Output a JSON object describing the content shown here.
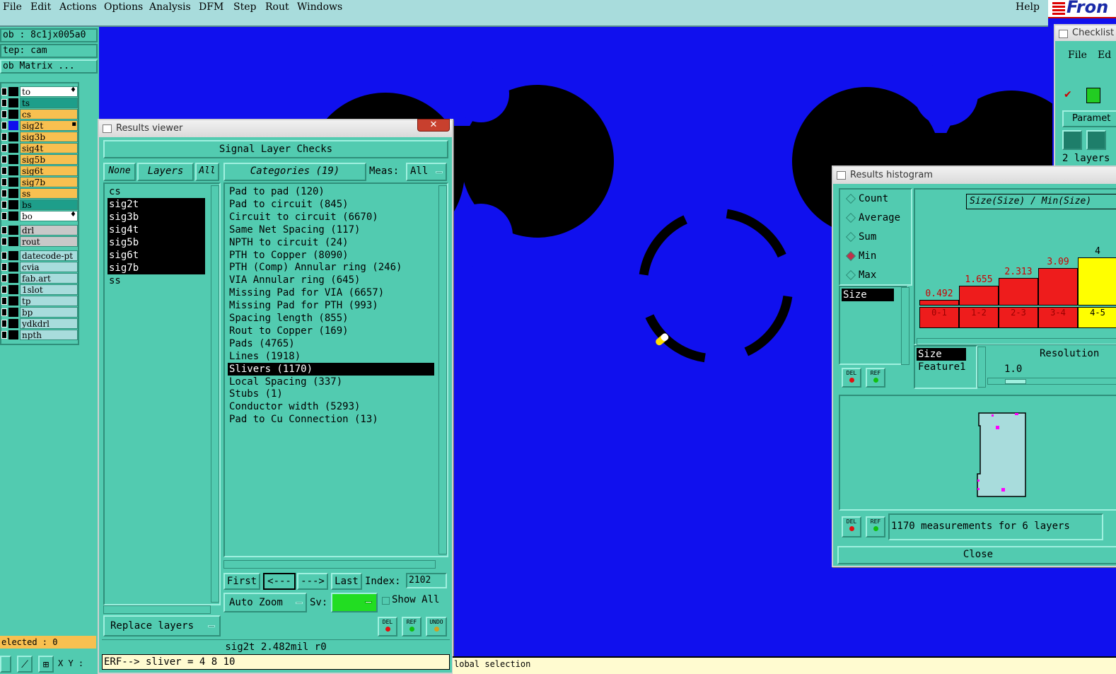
{
  "menubar": {
    "items": [
      "File",
      "Edit",
      "Actions",
      "Options",
      "Analysis",
      "DFM",
      "Step",
      "Rout",
      "Windows"
    ],
    "help": "Help",
    "logo": "Fron"
  },
  "left_panel": {
    "job": "ob : 8c1jx005a0",
    "step": "tep: cam",
    "job_matrix": "ob Matrix ...",
    "layers": [
      {
        "name": "to",
        "color": "#ffffff",
        "swatch": "#000000",
        "mark": "♦"
      },
      {
        "name": "ts",
        "color": "#1e9e8a",
        "swatch": "#000000",
        "mark": ""
      },
      {
        "name": "cs",
        "color": "#f8c050",
        "swatch": "#000000",
        "mark": ""
      },
      {
        "name": "sig2t",
        "color": "#f8c050",
        "swatch": "#1010ee",
        "mark": "▪"
      },
      {
        "name": "sig3b",
        "color": "#f8c050",
        "swatch": "#000000",
        "mark": ""
      },
      {
        "name": "sig4t",
        "color": "#f8c050",
        "swatch": "#000000",
        "mark": ""
      },
      {
        "name": "sig5b",
        "color": "#f8c050",
        "swatch": "#000000",
        "mark": ""
      },
      {
        "name": "sig6t",
        "color": "#f8c050",
        "swatch": "#000000",
        "mark": ""
      },
      {
        "name": "sig7b",
        "color": "#f8c050",
        "swatch": "#000000",
        "mark": ""
      },
      {
        "name": "ss",
        "color": "#f8c050",
        "swatch": "#000000",
        "mark": ""
      },
      {
        "name": "bs",
        "color": "#1e9e8a",
        "swatch": "#000000",
        "mark": ""
      },
      {
        "name": "bo",
        "color": "#ffffff",
        "swatch": "#000000",
        "mark": "♦"
      },
      {
        "name": "drl",
        "color": "#c8c8c8",
        "swatch": "#000000",
        "mark": ""
      },
      {
        "name": "rout",
        "color": "#c8c8c8",
        "swatch": "#000000",
        "mark": ""
      },
      {
        "name": "datecode-pt",
        "color": "#a8dcdc",
        "swatch": "#000000",
        "mark": ""
      },
      {
        "name": "cvia",
        "color": "#a8dcdc",
        "swatch": "#000000",
        "mark": ""
      },
      {
        "name": "fab.art",
        "color": "#a8dcdc",
        "swatch": "#000000",
        "mark": ""
      },
      {
        "name": "1slot",
        "color": "#a8dcdc",
        "swatch": "#000000",
        "mark": ""
      },
      {
        "name": "tp",
        "color": "#a8dcdc",
        "swatch": "#000000",
        "mark": ""
      },
      {
        "name": "bp",
        "color": "#a8dcdc",
        "swatch": "#000000",
        "mark": ""
      },
      {
        "name": "ydkdrl",
        "color": "#a8dcdc",
        "swatch": "#000000",
        "mark": ""
      },
      {
        "name": "npth",
        "color": "#a8dcdc",
        "swatch": "#000000",
        "mark": ""
      }
    ],
    "selected": "elected : 0",
    "xy_label": "X Y :"
  },
  "results_viewer": {
    "title": "Results viewer",
    "header": "Signal Layer Checks",
    "none_btn": "None",
    "layers_btn": "Layers",
    "all_btn": "All",
    "categories_btn": "Categories (19)",
    "meas_label": "Meas:",
    "meas_value": "All",
    "layer_list": [
      "cs",
      "sig2t",
      "sig3b",
      "sig4t",
      "sig5b",
      "sig6t",
      "sig7b",
      "ss"
    ],
    "selected_layers": [
      "sig2t",
      "sig3b",
      "sig4t",
      "sig5b",
      "sig6t",
      "sig7b"
    ],
    "categories": [
      "Pad to pad (120)",
      "Pad to circuit (845)",
      "Circuit to circuit (6670)",
      "Same Net Spacing (117)",
      "NPTH to circuit (24)",
      "PTH to Copper (8090)",
      "PTH (Comp) Annular ring (246)",
      "VIA Annular ring (645)",
      "Missing Pad for VIA (6657)",
      "Missing Pad for PTH (993)",
      "Spacing length (855)",
      "Rout to Copper (169)",
      "Pads (4765)",
      "Lines (1918)",
      "Slivers (1170)",
      "Local Spacing (337)",
      "Stubs (1)",
      "Conductor width (5293)",
      "Pad to Cu Connection (13)"
    ],
    "selected_category": "Slivers (1170)",
    "first_btn": "First",
    "prev_btn": "<---",
    "next_btn": "--->",
    "last_btn": "Last",
    "index_label": "Index:",
    "index_value": "2102",
    "auto_zoom": "Auto Zoom",
    "sv_label": "Sv:",
    "show_all": "Show All",
    "replace_layers": "Replace layers",
    "del_label": "DEL",
    "ref_label": "REF",
    "undo_label": "UNDO",
    "status_line": "sig2t 2.482mil  r0",
    "erf_line": "ERF--> sliver = 4 8 10"
  },
  "histogram": {
    "title": "Results histogram",
    "modes": [
      "Count",
      "Average",
      "Sum",
      "Min",
      "Max"
    ],
    "selected_mode": "Min",
    "size_item": "Size",
    "chart_title": "Size(Size) / Min(Size)",
    "resolution_label": "Resolution",
    "resolution_value": "1.0",
    "list_items": [
      "Size",
      "Feature1"
    ],
    "summary": "1170 measurements for 6 layers",
    "close_btn": "Close",
    "del_label": "DEL",
    "ref_label": "REF"
  },
  "chart_data": {
    "type": "bar",
    "title": "Size(Size) / Min(Size)",
    "categories": [
      "0-1",
      "1-2",
      "2-3",
      "3-4",
      "4-5"
    ],
    "values": [
      0.492,
      1.655,
      2.313,
      3.09,
      4
    ],
    "value_labels": [
      "0.492",
      "1.655",
      "2.313",
      "3.09",
      "4"
    ],
    "highlight": "4-5",
    "bar_color": "#ee1c1c",
    "highlight_color": "#ffff00",
    "xlabel": "",
    "ylabel": ""
  },
  "checklist": {
    "title": "Checklist",
    "menu": [
      "File",
      "Ed"
    ],
    "params": "Paramet",
    "layers": "2 layers"
  },
  "statusbar": {
    "text": "lobal selection"
  }
}
